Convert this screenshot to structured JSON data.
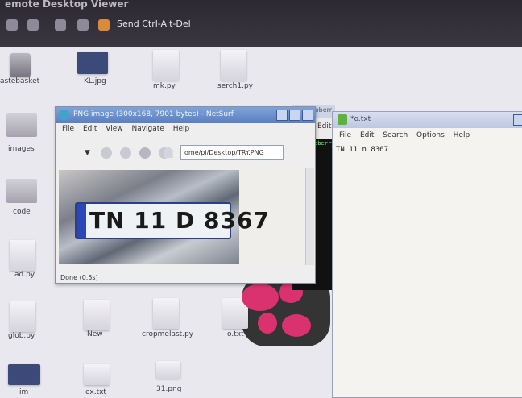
{
  "remote_bar": {
    "title": "emote Desktop Viewer",
    "send_label": "Send Ctrl-Alt-Del"
  },
  "desktop": {
    "icons_top": [
      "astebasket",
      "KL.jpg",
      "mk.py",
      "serch1.py"
    ],
    "icons_left": [
      "images",
      "code",
      "ad.py",
      "glob.py"
    ],
    "icons_bottom": [
      "New",
      "cropmelast.py",
      "o.txt",
      "ex.txt",
      "31.png"
    ],
    "icon_bottom_left": "im"
  },
  "netsurf": {
    "title": "PNG image (300x168, 7901 bytes) - NetSurf",
    "menu": [
      "File",
      "Edit",
      "View",
      "Navigate",
      "Help"
    ],
    "url": "ome/pi/Desktop/TRY.PNG",
    "status": "Done (0.5s)",
    "plate_text": "TN 11 D 8367"
  },
  "terminal": {
    "title": "i@raspberr",
    "edit_label": "Edit",
    "prompt_text": "pberry"
  },
  "leafpad": {
    "title": "*o.txt",
    "menu": [
      "File",
      "Edit",
      "Search",
      "Options",
      "Help"
    ],
    "text": "TN 11 n 8367"
  }
}
